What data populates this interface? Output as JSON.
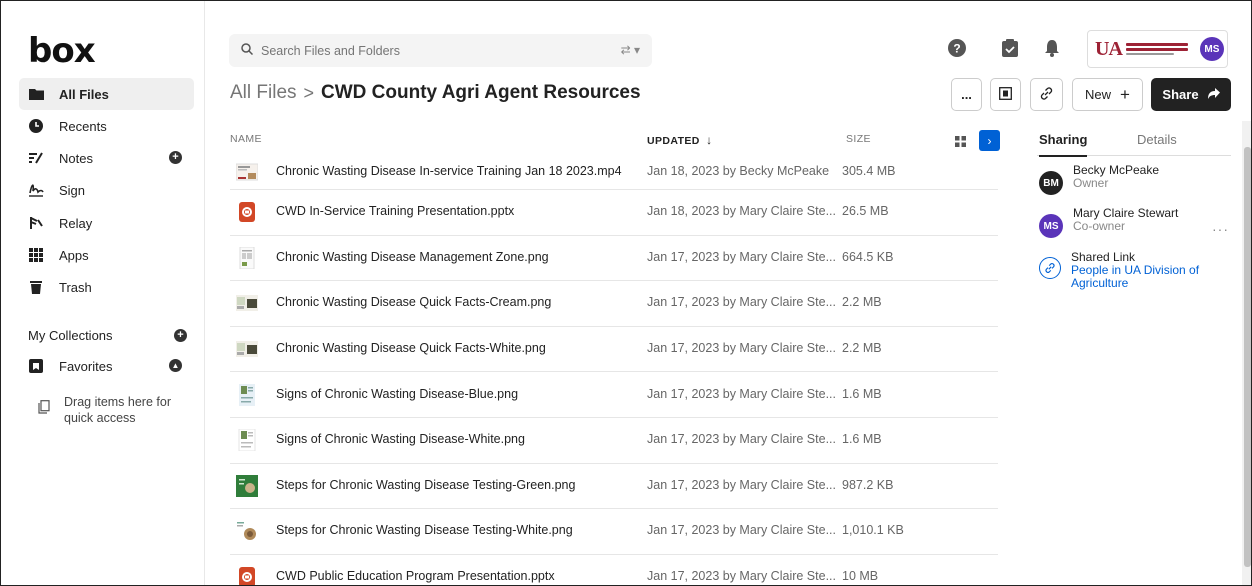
{
  "app": {
    "logo": "box"
  },
  "sidebar": {
    "items": [
      {
        "label": "All Files",
        "icon": "folder-icon"
      },
      {
        "label": "Recents",
        "icon": "clock-icon"
      },
      {
        "label": "Notes",
        "icon": "notes-icon"
      },
      {
        "label": "Sign",
        "icon": "sign-icon"
      },
      {
        "label": "Relay",
        "icon": "relay-icon"
      },
      {
        "label": "Apps",
        "icon": "apps-grid-icon"
      },
      {
        "label": "Trash",
        "icon": "trash-icon"
      }
    ],
    "collections_label": "My Collections",
    "favorites_label": "Favorites",
    "drag_hint": "Drag items here for quick access"
  },
  "search": {
    "placeholder": "Search Files and Folders"
  },
  "header": {
    "avatar_initials": "MS",
    "org_logo_text": "UA"
  },
  "breadcrumb": {
    "root": "All Files",
    "separator": ">",
    "current": "CWD County Agri Agent Resources"
  },
  "toolbar": {
    "more_label": "...",
    "new_label": "New",
    "share_label": "Share"
  },
  "table": {
    "columns": {
      "name": "NAME",
      "updated": "UPDATED",
      "size": "SIZE"
    },
    "rows": [
      {
        "name": "Chronic Wasting Disease In-service Training Jan 18 2023.mp4",
        "updated": "Jan 18, 2023 by Becky McPeake",
        "size": "305.4 MB",
        "type": "video"
      },
      {
        "name": "CWD In-Service Training Presentation.pptx",
        "updated": "Jan 18, 2023 by Mary Claire Ste...",
        "size": "26.5 MB",
        "type": "pptx"
      },
      {
        "name": "Chronic Wasting Disease Management Zone.png",
        "updated": "Jan 17, 2023 by Mary Claire Ste...",
        "size": "664.5 KB",
        "type": "png-doc"
      },
      {
        "name": "Chronic Wasting Disease Quick Facts-Cream.png",
        "updated": "Jan 17, 2023 by Mary Claire Ste...",
        "size": "2.2 MB",
        "type": "png-facts"
      },
      {
        "name": "Chronic Wasting Disease Quick Facts-White.png",
        "updated": "Jan 17, 2023 by Mary Claire Ste...",
        "size": "2.2 MB",
        "type": "png-facts"
      },
      {
        "name": "Signs of Chronic Wasting Disease-Blue.png",
        "updated": "Jan 17, 2023 by Mary Claire Ste...",
        "size": "1.6 MB",
        "type": "png-signs-blue"
      },
      {
        "name": "Signs of Chronic Wasting Disease-White.png",
        "updated": "Jan 17, 2023 by Mary Claire Ste...",
        "size": "1.6 MB",
        "type": "png-signs"
      },
      {
        "name": "Steps for Chronic Wasting Disease Testing-Green.png",
        "updated": "Jan 17, 2023 by Mary Claire Ste...",
        "size": "987.2 KB",
        "type": "png-green"
      },
      {
        "name": "Steps for Chronic Wasting Disease Testing-White.png",
        "updated": "Jan 17, 2023 by Mary Claire Ste...",
        "size": "1,010.1 KB",
        "type": "png-steps"
      },
      {
        "name": "CWD Public Education Program Presentation.pptx",
        "updated": "Jan 17, 2023 by Mary Claire Ste...",
        "size": "10 MB",
        "type": "pptx"
      }
    ]
  },
  "details_panel": {
    "tabs": [
      "Sharing",
      "Details"
    ],
    "people": [
      {
        "initials": "BM",
        "name": "Becky McPeake",
        "role": "Owner",
        "color": "#222222"
      },
      {
        "initials": "MS",
        "name": "Mary Claire Stewart",
        "role": "Co-owner",
        "color": "#5a34b9"
      }
    ],
    "shared_link": {
      "title": "Shared Link",
      "value": "People in UA Division of Agriculture"
    }
  },
  "colors": {
    "accent": "#0061d5",
    "avatar_ms": "#5a34b9",
    "pptx": "#d24726",
    "ua_red": "#9d2235"
  }
}
